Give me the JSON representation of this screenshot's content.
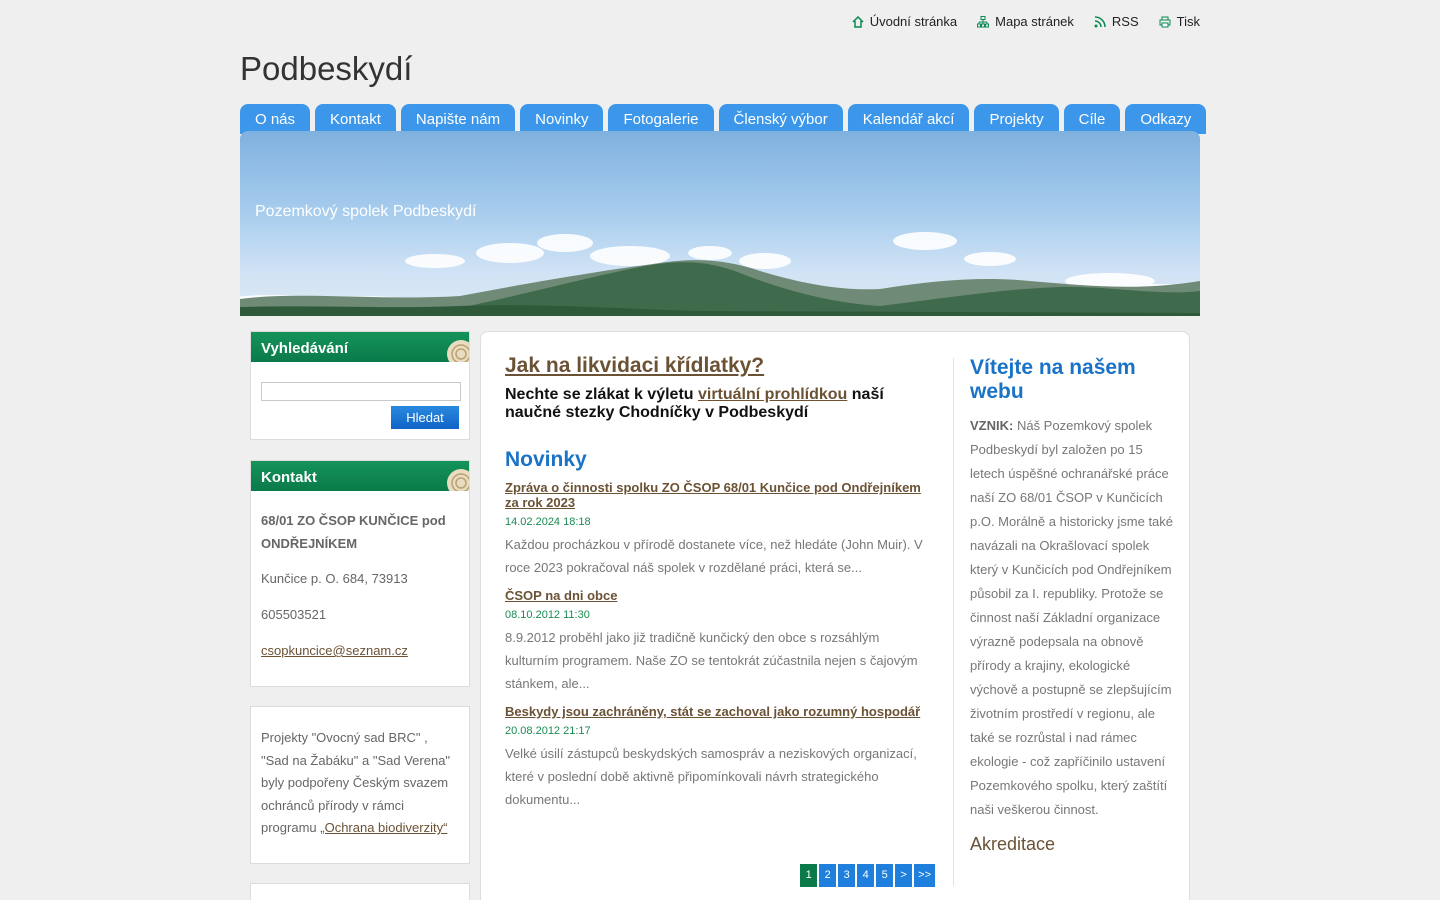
{
  "toplinks": [
    {
      "label": "Úvodní stránka",
      "icon": "home-icon"
    },
    {
      "label": "Mapa stránek",
      "icon": "sitemap-icon"
    },
    {
      "label": "RSS",
      "icon": "rss-icon"
    },
    {
      "label": "Tisk",
      "icon": "print-icon"
    }
  ],
  "site_title": "Podbeskydí",
  "nav": [
    "O nás",
    "Kontakt",
    "Napište nám",
    "Novinky",
    "Fotogalerie",
    "Členský výbor",
    "Kalendář akcí",
    "Projekty",
    "Cíle",
    "Odkazy"
  ],
  "banner_text": "Pozemkový spolek Podbeskydí",
  "search": {
    "title": "Vyhledávání",
    "button": "Hledat",
    "value": ""
  },
  "contact": {
    "title": "Kontakt",
    "org": "68/01 ZO ČSOP KUNČICE pod ONDŘEJNÍKEM",
    "address": "Kunčice p. O. 684, 73913",
    "phone": "605503521",
    "email": "csopkuncice@seznam.cz"
  },
  "projects": {
    "text": "Projekty \"Ovocný sad BRC\" , \"Sad na Žabáku\" a \"Sad Verena\" byly podpořeny Českým svazem ochránců přírody v rámci programu ",
    "link": "„Ochrana biodiverzity“"
  },
  "feature": {
    "title": "Jak na likvidaci křídlatky?",
    "sub_before": "Nechte se zlákat k výletu ",
    "sub_link": "virtuální prohlídkou",
    "sub_after": " naší naučné stezky Chodníčky v Podbeskydí"
  },
  "news": {
    "title": "Novinky",
    "items": [
      {
        "title": "Zpráva o činnosti spolku ZO ČSOP 68/01 Kunčice pod Ondřejníkem za rok 2023",
        "date": "14.02.2024 18:18",
        "text": "Každou procházkou v přírodě dostanete více, než hledáte (John Muir). V roce 2023 pokračoval náš spolek v rozdělané práci, která se..."
      },
      {
        "title": "ČSOP na dni obce",
        "date": "08.10.2012 11:30",
        "text": "8.9.2012 proběhl jako již tradičně kunčický den obce s rozsáhlým kulturním programem. Naše ZO se tentokrát zúčastnila nejen s čajovým stánkem, ale..."
      },
      {
        "title": "Beskydy jsou zachráněny, stát se zachoval jako rozumný hospodář",
        "date": "20.08.2012 21:17",
        "text": "Velké úsilí zástupců beskydských samospráv a neziskových organizací, které v poslední době aktivně připomínkovali návrh strategického dokumentu..."
      }
    ],
    "pager": [
      "1",
      "2",
      "3",
      "4",
      "5",
      ">",
      ">>"
    ],
    "pager_active": "1"
  },
  "welcome": {
    "title": "Vítejte na našem webu",
    "lead": "VZNIK:",
    "text": " Náš Pozemkový spolek Podbeskydí byl založen po 15 letech úspěšné ochranářské práce naší ZO 68/01 ČSOP v Kunčicích p.O. Morálně a historicky jsme také navázali na Okrašlovací spolek který v Kunčicích pod Ondřejníkem působil za I. republiky. Protože se činnost naší Základní organizace výrazně podepsala na obnově přírody a krajiny, ekologické výchově a postupně se zlepšujícím životním prostředí v regionu, ale také se rozrůstal i nad rámec ekologie - což zapříčinilo ustavení Pozemkového spolku, který zaštítí naši veškerou činnost.",
    "next_heading": "Akreditace"
  },
  "colors": {
    "nav": "#3c97eb",
    "box_header": "#0a7a4a",
    "link": "#6b5235",
    "heading_blue": "#1a73c6",
    "date_green": "#1b8a52"
  }
}
